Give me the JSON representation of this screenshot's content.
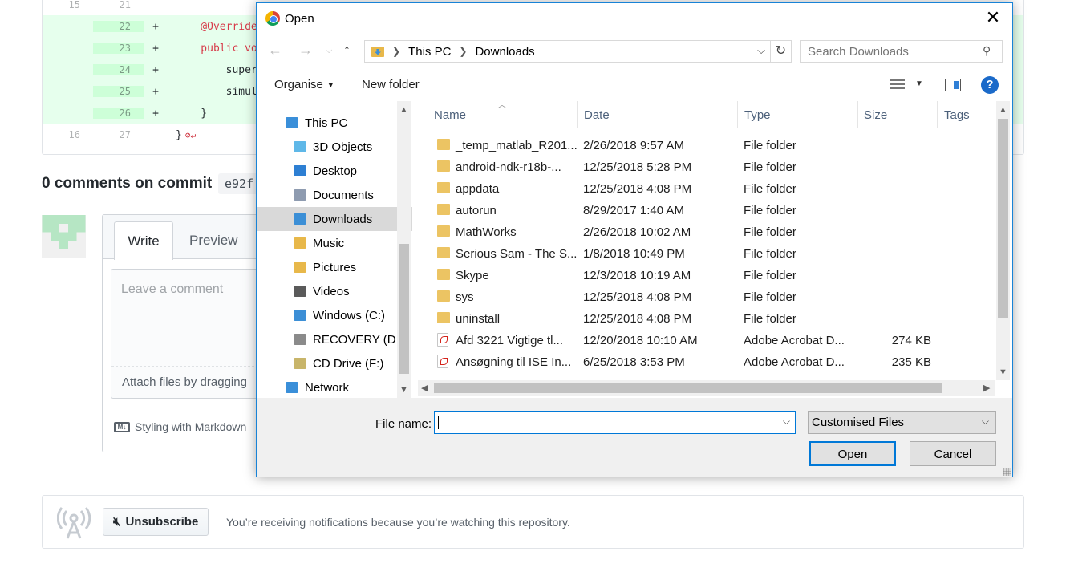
{
  "diff": {
    "rows": [
      {
        "old": "15",
        "new": "21",
        "sign": "",
        "code": "",
        "added": false
      },
      {
        "old": "",
        "new": "22",
        "sign": "+",
        "code": "    @Override",
        "added": true
      },
      {
        "old": "",
        "new": "23",
        "sign": "+",
        "code": "    public vo",
        "added": true
      },
      {
        "old": "",
        "new": "24",
        "sign": "+",
        "code": "        super",
        "added": true
      },
      {
        "old": "",
        "new": "25",
        "sign": "+",
        "code": "        simul",
        "added": true
      },
      {
        "old": "",
        "new": "26",
        "sign": "+",
        "code": "    }",
        "added": true
      },
      {
        "old": "16",
        "new": "27",
        "sign": "",
        "code": "}",
        "added": false
      }
    ]
  },
  "comments": {
    "title": "0 comments on commit",
    "sha": "e92f"
  },
  "comment_form": {
    "tab_write": "Write",
    "tab_preview": "Preview",
    "placeholder": "Leave a comment",
    "attach_text": "Attach files by dragging",
    "markdown_note": "Styling with Markdown",
    "markdown_icon": "M↓"
  },
  "notifications": {
    "unsubscribe_label": "Unsubscribe",
    "message": "You’re receiving notifications because you’re watching this repository."
  },
  "dialog": {
    "title": "Open",
    "breadcrumb": [
      "This PC",
      "Downloads"
    ],
    "search_placeholder": "Search Downloads",
    "organise_label": "Organise",
    "new_folder_label": "New folder",
    "help_label": "?",
    "nav_items": [
      {
        "label": "This PC",
        "icon": "pc-icon",
        "color": "#3a8fd9",
        "indent": 55,
        "selected": false
      },
      {
        "label": "3D Objects",
        "icon": "3d-objects-icon",
        "color": "#5fb8e8",
        "indent": 65,
        "selected": false
      },
      {
        "label": "Desktop",
        "icon": "desktop-icon",
        "color": "#2d7fd3",
        "indent": 65,
        "selected": false
      },
      {
        "label": "Documents",
        "icon": "documents-icon",
        "color": "#8e9bb0",
        "indent": 65,
        "selected": false
      },
      {
        "label": "Downloads",
        "icon": "downloads-icon",
        "color": "#3c8fd6",
        "indent": 65,
        "selected": true
      },
      {
        "label": "Music",
        "icon": "music-icon",
        "color": "#e8b84a",
        "indent": 65,
        "selected": false
      },
      {
        "label": "Pictures",
        "icon": "pictures-icon",
        "color": "#e8b84a",
        "indent": 65,
        "selected": false
      },
      {
        "label": "Videos",
        "icon": "videos-icon",
        "color": "#5a5a5a",
        "indent": 65,
        "selected": false
      },
      {
        "label": "Windows (C:)",
        "icon": "drive-c-icon",
        "color": "#3c8fd6",
        "indent": 65,
        "selected": false
      },
      {
        "label": "RECOVERY (D:)",
        "icon": "drive-d-icon",
        "color": "#8a8a8a",
        "indent": 65,
        "selected": false
      },
      {
        "label": "CD Drive (F:)",
        "icon": "cd-drive-icon",
        "color": "#c8b56a",
        "indent": 65,
        "selected": false
      },
      {
        "label": "Network",
        "icon": "network-icon",
        "color": "#3a8fd9",
        "indent": 55,
        "selected": false
      }
    ],
    "columns": [
      "Name",
      "Date",
      "Type",
      "Size",
      "Tags"
    ],
    "files": [
      {
        "name": "_temp_matlab_R201...",
        "date": "2/26/2018 9:57 AM",
        "type": "File folder",
        "size": "",
        "kind": "folder"
      },
      {
        "name": "android-ndk-r18b-...",
        "date": "12/25/2018 5:28 PM",
        "type": "File folder",
        "size": "",
        "kind": "folder"
      },
      {
        "name": "appdata",
        "date": "12/25/2018 4:08 PM",
        "type": "File folder",
        "size": "",
        "kind": "folder"
      },
      {
        "name": "autorun",
        "date": "8/29/2017 1:40 AM",
        "type": "File folder",
        "size": "",
        "kind": "folder"
      },
      {
        "name": "MathWorks",
        "date": "2/26/2018 10:02 AM",
        "type": "File folder",
        "size": "",
        "kind": "folder"
      },
      {
        "name": "Serious Sam - The S...",
        "date": "1/8/2018 10:49 PM",
        "type": "File folder",
        "size": "",
        "kind": "folder"
      },
      {
        "name": "Skype",
        "date": "12/3/2018 10:19 AM",
        "type": "File folder",
        "size": "",
        "kind": "folder"
      },
      {
        "name": "sys",
        "date": "12/25/2018 4:08 PM",
        "type": "File folder",
        "size": "",
        "kind": "folder"
      },
      {
        "name": "uninstall",
        "date": "12/25/2018 4:08 PM",
        "type": "File folder",
        "size": "",
        "kind": "folder"
      },
      {
        "name": "Afd  3221  Vigtige tl...",
        "date": "12/20/2018 10:10 AM",
        "type": "Adobe Acrobat D...",
        "size": "274 KB",
        "kind": "pdf"
      },
      {
        "name": "Ansøgning til ISE In...",
        "date": "6/25/2018 3:53 PM",
        "type": "Adobe Acrobat D...",
        "size": "235 KB",
        "kind": "pdf"
      }
    ],
    "filename_label": "File name:",
    "filename_value": "",
    "filter_value": "Customised Files",
    "open_label": "Open",
    "cancel_label": "Cancel"
  }
}
